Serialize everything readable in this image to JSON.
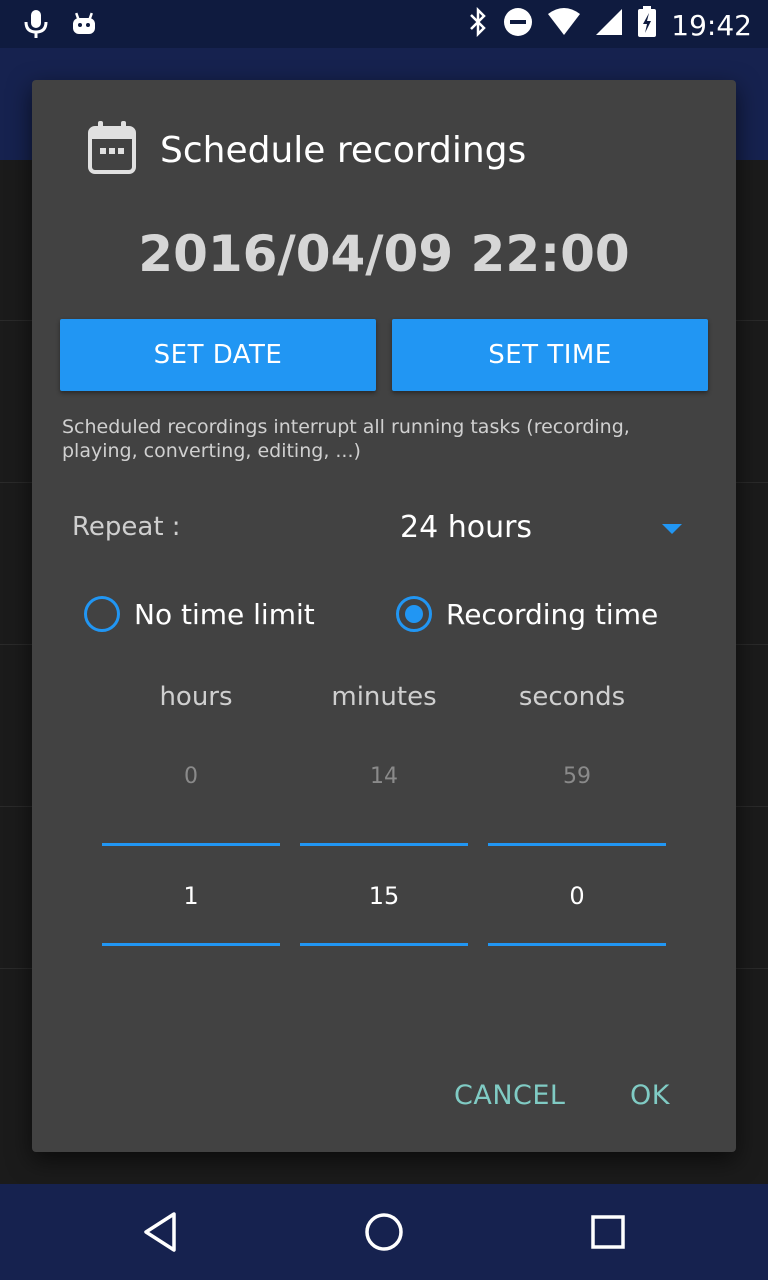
{
  "status_bar": {
    "time": "19:42"
  },
  "dialog": {
    "title": "Schedule recordings",
    "datetime": "2016/04/09 22:00",
    "set_date_label": "SET DATE",
    "set_time_label": "SET TIME",
    "note": "Scheduled recordings interrupt all running tasks (recording, playing, converting, editing, ...)",
    "repeat": {
      "label": "Repeat :",
      "value": "24 hours"
    },
    "radio_options": [
      {
        "label": "No time limit",
        "selected": false
      },
      {
        "label": "Recording time",
        "selected": true
      }
    ],
    "picker": {
      "columns": [
        {
          "header": "hours",
          "previous": "0",
          "current": "1"
        },
        {
          "header": "minutes",
          "previous": "14",
          "current": "15"
        },
        {
          "header": "seconds",
          "previous": "59",
          "current": "0"
        }
      ]
    },
    "cancel_label": "CANCEL",
    "ok_label": "OK"
  },
  "colors": {
    "accent": "#2196f3",
    "action": "#80cbc4",
    "dialog_bg": "#424242",
    "bar_bg": "#16224f"
  }
}
